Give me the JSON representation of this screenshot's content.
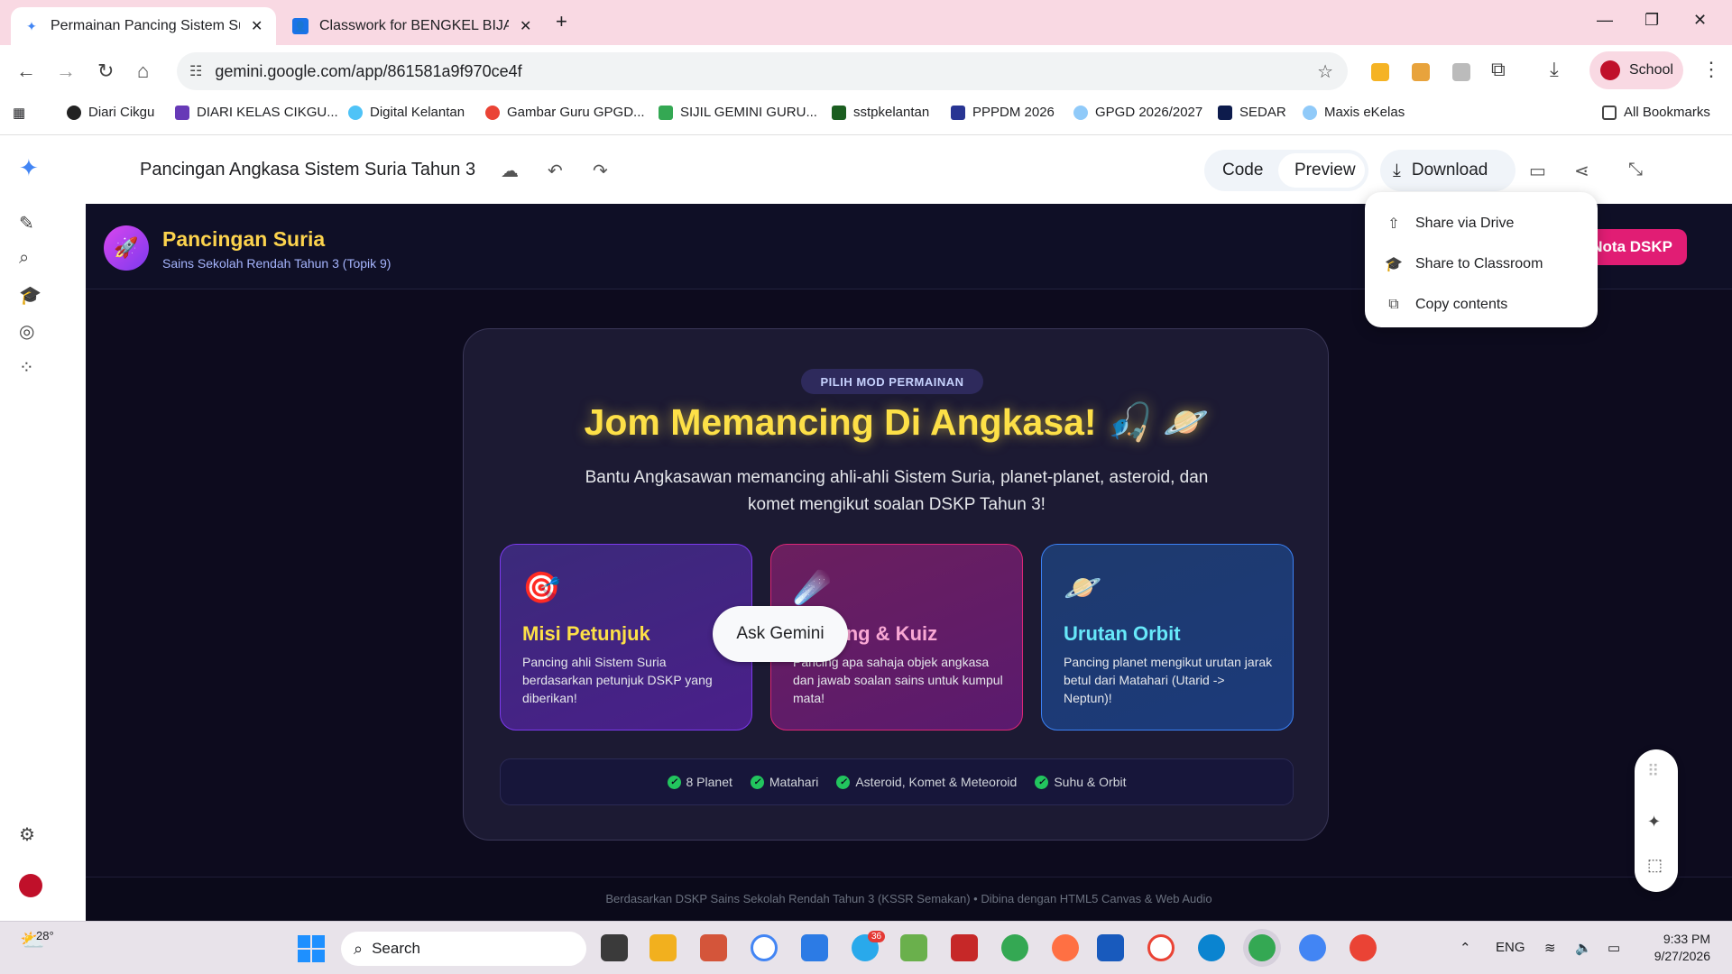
{
  "browser": {
    "tabs": [
      {
        "title": "Permainan Pancing Sistem Suria",
        "active": true
      },
      {
        "title": "Classwork for BENGKEL BIJAK D",
        "active": false
      }
    ],
    "url": "gemini.google.com/app/861581a9f970ce4f",
    "profile": "School",
    "bookmarks": [
      "Diari Cikgu",
      "DIARI KELAS CIKGU...",
      "Digital Kelantan",
      "Gambar Guru GPGD...",
      "SIJIL GEMINI GURU...",
      "sstpkelantan",
      "PPPDM 2026",
      "GPGD 2026/2027",
      "SEDAR",
      "Maxis eKelas"
    ],
    "all_bookmarks": "All Bookmarks"
  },
  "app": {
    "title": "Pancingan Angkasa Sistem Suria Tahun 3",
    "code_label": "Code",
    "preview_label": "Preview",
    "download_label": "Download",
    "share_menu": [
      "Share via Drive",
      "Share to Classroom",
      "Copy contents"
    ],
    "ask_gemini": "Ask Gemini"
  },
  "game": {
    "name": "Pancingan Suria",
    "subtitle": "Sains Sekolah Rendah Tahun 3 (Topik 9)",
    "nota_button": "Nota DSKP",
    "mode_pill": "PILIH MOD PERMAINAN",
    "headline": "Jom Memancing Di Angkasa! 🎣 🪐",
    "intro": "Bantu Angkasawan memancing ahli-ahli Sistem Suria, planet-planet, asteroid, dan komet mengikut soalan DSKP Tahun 3!",
    "cards": [
      {
        "icon": "🎯",
        "title": "Misi Petunjuk",
        "desc": "Pancing ahli Sistem Suria berdasarkan petunjuk DSKP yang diberikan!"
      },
      {
        "icon": "☄️",
        "title": "Pancing & Kuiz",
        "desc": "Pancing apa sahaja objek angkasa dan jawab soalan sains untuk kumpul mata!"
      },
      {
        "icon": "🪐",
        "title": "Urutan Orbit",
        "desc": "Pancing planet mengikut urutan jarak betul dari Matahari (Utarid -> Neptun)!"
      }
    ],
    "topics": [
      "8 Planet",
      "Matahari",
      "Asteroid, Komet & Meteoroid",
      "Suhu & Orbit"
    ],
    "footer": "Berdasarkan DSKP Sains Sekolah Rendah Tahun 3 (KSSR Semakan) • Dibina dengan HTML5 Canvas & Web Audio"
  },
  "taskbar": {
    "weather": "28°",
    "search": "Search",
    "lang": "ENG",
    "time": "9:33 PM",
    "date": "9/27/2026",
    "telegram_badge": "36"
  }
}
